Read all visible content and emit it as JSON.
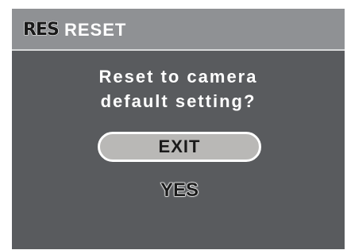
{
  "title_bar": {
    "icon_label": "RES",
    "icon_name": "reset-icon",
    "title": "RESET"
  },
  "dialog": {
    "prompt_line1": "Reset to camera",
    "prompt_line2": "default setting?"
  },
  "options": {
    "exit_label": "EXIT",
    "yes_label": "YES",
    "selected": "EXIT"
  },
  "colors": {
    "screen_background": "#595b5e",
    "title_bar_background": "#8f9194",
    "selected_option_fill": "#b9b8b6",
    "text": "#ffffff"
  }
}
